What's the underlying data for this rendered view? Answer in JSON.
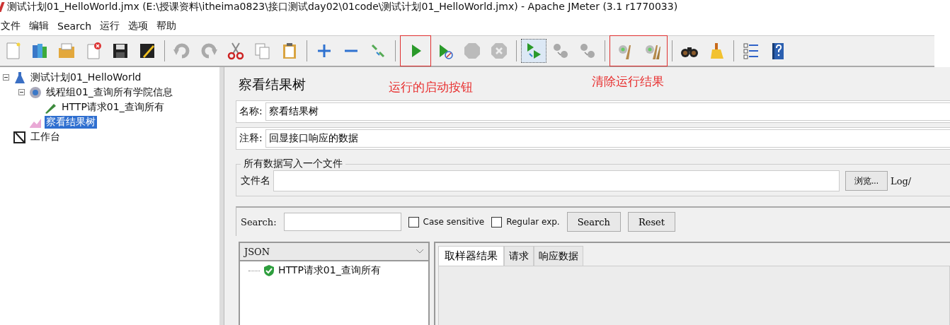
{
  "window": {
    "title": "测试计划01_HelloWorld.jmx (E:\\授课资料\\itheima0823\\接口测试day02\\01code\\测试计划01_HelloWorld.jmx) - Apache JMeter (3.1 r1770033)"
  },
  "menu": [
    "文件",
    "编辑",
    "Search",
    "运行",
    "选项",
    "帮助"
  ],
  "annotations": [
    {
      "text": "运行的启动按钮"
    },
    {
      "text": "清除运行结果"
    }
  ],
  "tree": [
    {
      "label": "测试计划01_HelloWorld",
      "kind": "plan",
      "expanded": true,
      "selected": false,
      "children": [
        {
          "label": "线程组01_查询所有学院信息",
          "kind": "threads",
          "expanded": true,
          "selected": false,
          "children": [
            {
              "label": "HTTP请求01_查询所有",
              "kind": "sampler",
              "selected": false
            }
          ]
        },
        {
          "label": "察看结果树",
          "kind": "listener",
          "selected": true
        }
      ]
    },
    {
      "label": "工作台",
      "kind": "workbench",
      "selected": false
    }
  ],
  "panel": {
    "title": "察看结果树",
    "name_label": "名称:",
    "name_value": "察看结果树",
    "comment_label": "注释:",
    "comment_value": "回显接口响应的数据",
    "file_group": {
      "legend": "所有数据写入一个文件",
      "filename_label": "文件名",
      "browse_button": "浏览...",
      "log_label": "Log/"
    },
    "search": {
      "label": "Search:",
      "checkboxes": [
        {
          "label": "Case sensitive",
          "checked": false
        },
        {
          "label": "Regular exp.",
          "checked": false
        }
      ],
      "search_button": "Search",
      "reset_button": "Reset"
    },
    "renderer": "JSON",
    "results": [
      {
        "label": "HTTP请求01_查询所有",
        "success": true
      }
    ],
    "tabs": [
      {
        "label": "取样器结果",
        "selected": true
      },
      {
        "label": "请求",
        "selected": false
      },
      {
        "label": "响应数据",
        "selected": false
      }
    ]
  }
}
